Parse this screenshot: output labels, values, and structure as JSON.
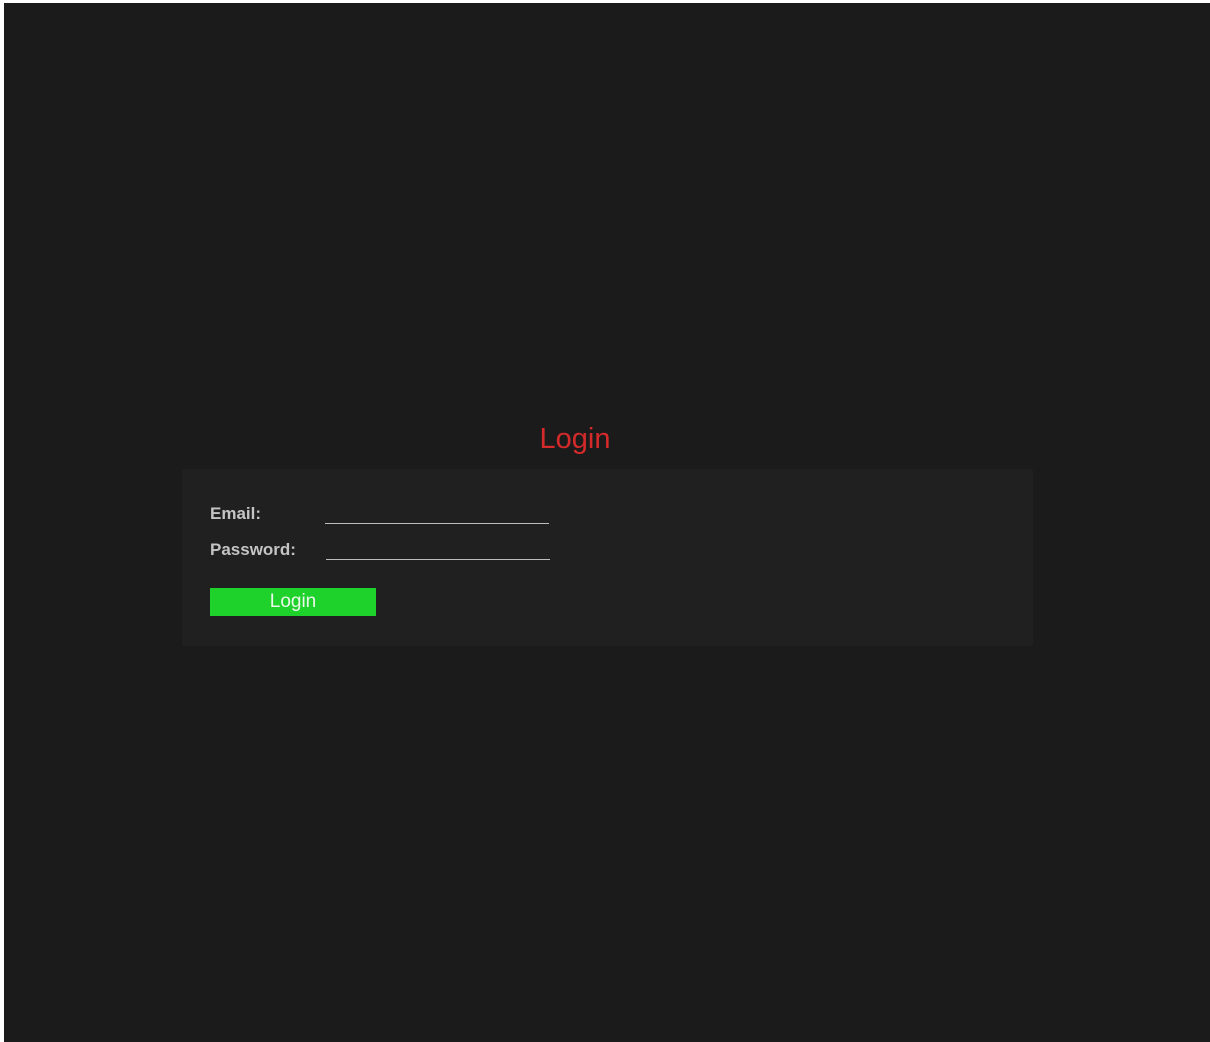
{
  "page": {
    "title": "Login"
  },
  "form": {
    "email": {
      "label": "Email:",
      "value": "",
      "placeholder": ""
    },
    "password": {
      "label": "Password:",
      "value": "",
      "placeholder": ""
    },
    "submit_label": "Login"
  },
  "colors": {
    "background": "#1b1b1b",
    "panel": "#202020",
    "title": "#d42a2a",
    "label": "#c4c4c4",
    "button": "#1fd12b",
    "button_text": "#e9f8ea"
  }
}
